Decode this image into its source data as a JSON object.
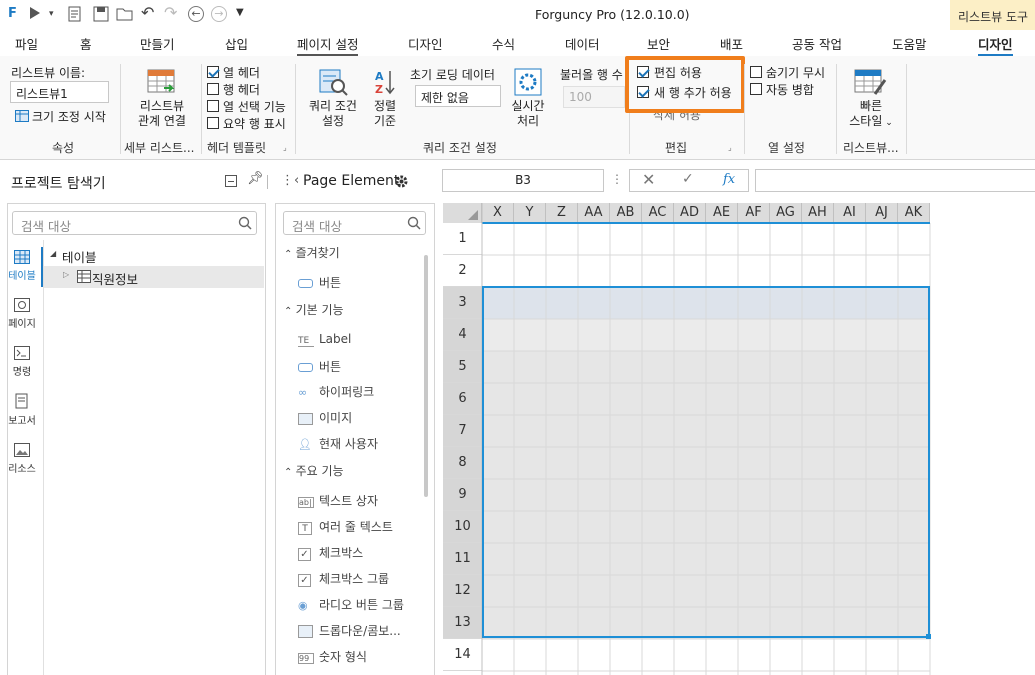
{
  "app_title": "Forguncy Pro (12.0.10.0)",
  "context_tab": "리스트뷰 도구",
  "menu": [
    "파일",
    "홈",
    "만들기",
    "삽입",
    "페이지 설정",
    "디자인",
    "수식",
    "데이터",
    "보안",
    "배포",
    "공동 작업",
    "도움말",
    "디자인"
  ],
  "ribbon": {
    "name_label": "리스트뷰 이름:",
    "name_value": "리스트뷰1",
    "resize_label": "크기 조정 시작",
    "grp_props": "속성",
    "relation_label1": "리스트뷰",
    "relation_label2": "관계 연결",
    "grp_detail": "세부 리스트...",
    "header_opts": [
      "열 헤더",
      "행 헤더",
      "열 선택 기능",
      "요약 행 표시"
    ],
    "grp_header": "헤더 템플릿",
    "query_label1": "쿼리 조건",
    "query_label2": "설정",
    "sort_label1": "정렬",
    "sort_label2": "기준",
    "initial_load": "초기 로딩 데이터",
    "initial_value": "제한 없음",
    "realtime1": "실시간",
    "realtime2": "처리",
    "load_rows": "불러올 행 수",
    "load_rows_value": "100",
    "grp_query": "쿼리 조건 설정",
    "edit_opts": [
      "편집 허용",
      "새 행 추가 허용",
      "삭제 허용"
    ],
    "grp_edit": "편집",
    "col_opts": [
      "숨기기 무시",
      "자동 병합"
    ],
    "grp_col": "열 설정",
    "quick1": "빠른",
    "quick2": "스타일",
    "grp_list": "리스트뷰..."
  },
  "explorer": {
    "title": "프로젝트 탐색기",
    "search_placeholder": "검색 대상",
    "tabs": [
      "테이블",
      "페이지",
      "명령",
      "보고서",
      "리소스"
    ],
    "tree_root": "테이블",
    "tree_child": "직원정보"
  },
  "page_element": {
    "title": "Page Element",
    "search_placeholder": "검색 대상",
    "sections": [
      {
        "label": "즐겨찾기",
        "items": [
          "버튼"
        ]
      },
      {
        "label": "기본 기능",
        "items": [
          "Label",
          "버튼",
          "하이퍼링크",
          "이미지",
          "현재 사용자"
        ]
      },
      {
        "label": "주요 기능",
        "items": [
          "텍스트 상자",
          "여러 줄 텍스트",
          "체크박스",
          "체크박스 그룹",
          "라디오 버튼 그룹",
          "드롭다운/콤보...",
          "숫자 형식"
        ]
      }
    ]
  },
  "formula": {
    "cell_ref": "B3",
    "fx": "fx"
  },
  "grid": {
    "columns": [
      "X",
      "Y",
      "Z",
      "AA",
      "AB",
      "AC",
      "AD",
      "AE",
      "AF",
      "AG",
      "AH",
      "AI",
      "AJ",
      "AK"
    ],
    "rows": [
      "1",
      "2",
      "3",
      "4",
      "5",
      "6",
      "7",
      "8",
      "9",
      "10",
      "11",
      "12",
      "13",
      "14"
    ]
  },
  "colors": {
    "accent": "#1e7bc4",
    "highlight": "#f07e1c",
    "ribbon_bg": "#f9f9f9"
  }
}
